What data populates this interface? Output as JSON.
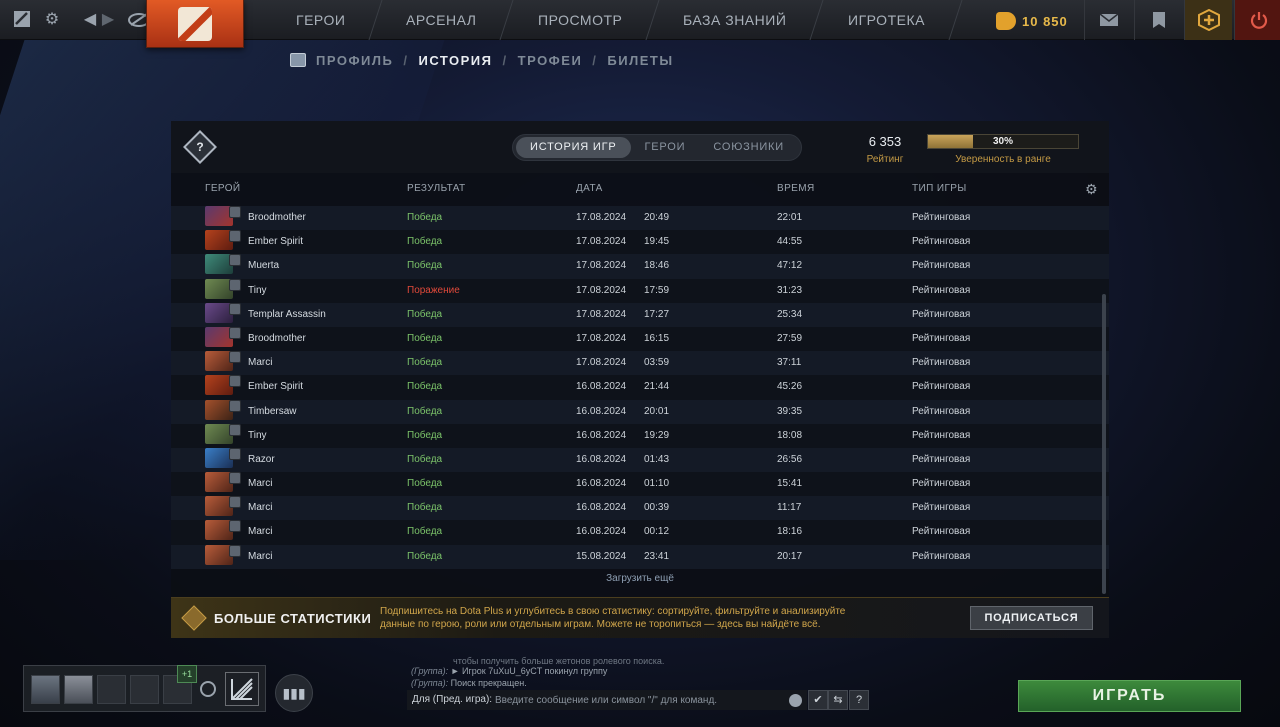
{
  "colors": {
    "accent_gold": "#c49a45",
    "win": "#7cc46a",
    "loss": "#e0493a",
    "play_green": "#3d8a3c"
  },
  "topbar": {
    "nav": [
      "ГЕРОИ",
      "АРСЕНАЛ",
      "ПРОСМОТР",
      "БАЗА ЗНАНИЙ",
      "ИГРОТЕКА"
    ],
    "currency": "10 850"
  },
  "subnav": {
    "items": [
      "ПРОФИЛЬ",
      "ИСТОРИЯ",
      "ТРОФЕИ",
      "БИЛЕТЫ"
    ],
    "separator": "/",
    "active": "ИСТОРИЯ"
  },
  "rank": {
    "emblem_mark": "?"
  },
  "tabs": [
    "ИСТОРИЯ ИГР",
    "ГЕРОИ",
    "СОЮЗНИКИ"
  ],
  "rating": {
    "value": "6 353",
    "label": "Рейтинг",
    "confidence_pct": 30,
    "confidence_text": "30%",
    "confidence_label": "Уверенность в ранге"
  },
  "table": {
    "headers": {
      "hero": "ГЕРОЙ",
      "result": "РЕЗУЛЬТАТ",
      "date": "ДАТА",
      "duration": "ВРЕМЯ",
      "type": "ТИП ИГРЫ"
    },
    "rows": [
      {
        "hero": "Broodmother",
        "result": "Победа",
        "win": true,
        "date": "17.08.2024",
        "time": "20:49",
        "duration": "22:01",
        "type": "Рейтинговая"
      },
      {
        "hero": "Ember Spirit",
        "result": "Победа",
        "win": true,
        "date": "17.08.2024",
        "time": "19:45",
        "duration": "44:55",
        "type": "Рейтинговая"
      },
      {
        "hero": "Muerta",
        "result": "Победа",
        "win": true,
        "date": "17.08.2024",
        "time": "18:46",
        "duration": "47:12",
        "type": "Рейтинговая"
      },
      {
        "hero": "Tiny",
        "result": "Поражение",
        "win": false,
        "date": "17.08.2024",
        "time": "17:59",
        "duration": "31:23",
        "type": "Рейтинговая"
      },
      {
        "hero": "Templar Assassin",
        "result": "Победа",
        "win": true,
        "date": "17.08.2024",
        "time": "17:27",
        "duration": "25:34",
        "type": "Рейтинговая"
      },
      {
        "hero": "Broodmother",
        "result": "Победа",
        "win": true,
        "date": "17.08.2024",
        "time": "16:15",
        "duration": "27:59",
        "type": "Рейтинговая"
      },
      {
        "hero": "Marci",
        "result": "Победа",
        "win": true,
        "date": "17.08.2024",
        "time": "03:59",
        "duration": "37:11",
        "type": "Рейтинговая"
      },
      {
        "hero": "Ember Spirit",
        "result": "Победа",
        "win": true,
        "date": "16.08.2024",
        "time": "21:44",
        "duration": "45:26",
        "type": "Рейтинговая"
      },
      {
        "hero": "Timbersaw",
        "result": "Победа",
        "win": true,
        "date": "16.08.2024",
        "time": "20:01",
        "duration": "39:35",
        "type": "Рейтинговая"
      },
      {
        "hero": "Tiny",
        "result": "Победа",
        "win": true,
        "date": "16.08.2024",
        "time": "19:29",
        "duration": "18:08",
        "type": "Рейтинговая"
      },
      {
        "hero": "Razor",
        "result": "Победа",
        "win": true,
        "date": "16.08.2024",
        "time": "01:43",
        "duration": "26:56",
        "type": "Рейтинговая"
      },
      {
        "hero": "Marci",
        "result": "Победа",
        "win": true,
        "date": "16.08.2024",
        "time": "01:10",
        "duration": "15:41",
        "type": "Рейтинговая"
      },
      {
        "hero": "Marci",
        "result": "Победа",
        "win": true,
        "date": "16.08.2024",
        "time": "00:39",
        "duration": "11:17",
        "type": "Рейтинговая"
      },
      {
        "hero": "Marci",
        "result": "Победа",
        "win": true,
        "date": "16.08.2024",
        "time": "00:12",
        "duration": "18:16",
        "type": "Рейтинговая"
      },
      {
        "hero": "Marci",
        "result": "Победа",
        "win": true,
        "date": "15.08.2024",
        "time": "23:41",
        "duration": "20:17",
        "type": "Рейтинговая"
      }
    ],
    "load_more": "Загрузить ещё"
  },
  "plus_banner": {
    "title": "БОЛЬШЕ СТАТИСТИКИ",
    "description": "Подпишитесь на Dota Plus и углубитесь в свою статистику: сортируйте, фильтруйте и анализируйте данные по герою, роли или отдельным играм. Можете не торопиться — здесь вы найдёте всё.",
    "button": "ПОДПИСАТЬСЯ"
  },
  "party": {
    "plus_badge": "+1"
  },
  "chat": {
    "line0": "чтобы получить больше жетонов ролевого поиска.",
    "line1_prefix": "(Группа):",
    "line1_text": "► Игрок 7uXuU_6yCT покинул группу",
    "line2_prefix": "(Группа):",
    "line2_text": "Поиск прекращен.",
    "input_prefix": "Для (Пред. игра):",
    "placeholder": "Введите сообщение или символ \"/\" для команд.",
    "help_btn": "?"
  },
  "play_button": "ИГРАТЬ"
}
